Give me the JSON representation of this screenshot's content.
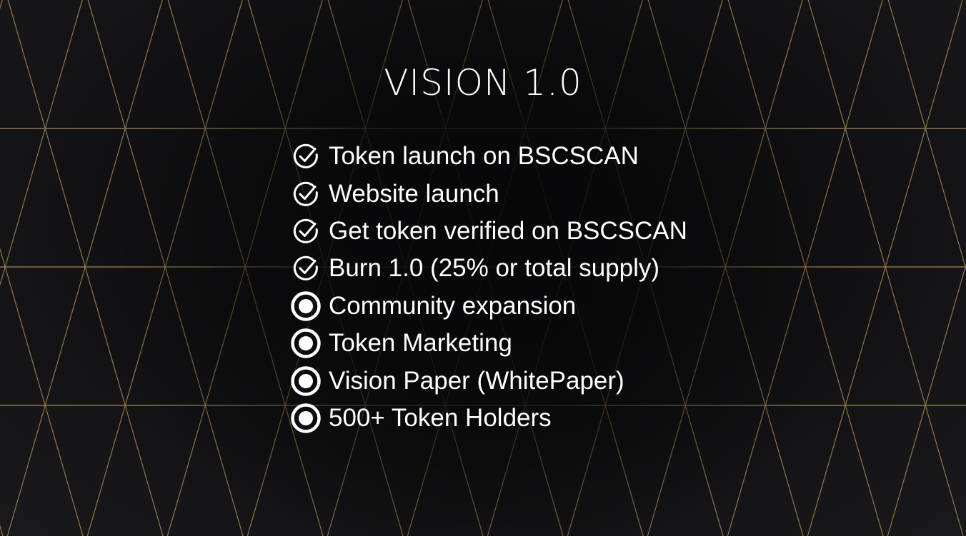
{
  "slide": {
    "title": "VISION 1.0",
    "accent_color": "#b8975a",
    "text_color": "#ffffff",
    "background_color": "#0d0d0e",
    "items": [
      {
        "label": "Token launch on BSCSCAN",
        "status": "completed",
        "icon": "check-circle-icon"
      },
      {
        "label": "Website launch",
        "status": "completed",
        "icon": "check-circle-icon"
      },
      {
        "label": "Get token verified on BSCSCAN",
        "status": "completed",
        "icon": "check-circle-icon"
      },
      {
        "label": "Burn 1.0 (25% or total supply)",
        "status": "completed",
        "icon": "check-circle-icon"
      },
      {
        "label": "Community expansion",
        "status": "pending",
        "icon": "radio-circle-icon"
      },
      {
        "label": "Token Marketing",
        "status": "pending",
        "icon": "radio-circle-icon"
      },
      {
        "label": "Vision Paper (WhitePaper)",
        "status": "pending",
        "icon": "radio-circle-icon"
      },
      {
        "label": "500+ Token Holders",
        "status": "pending",
        "icon": "radio-circle-icon"
      }
    ]
  }
}
